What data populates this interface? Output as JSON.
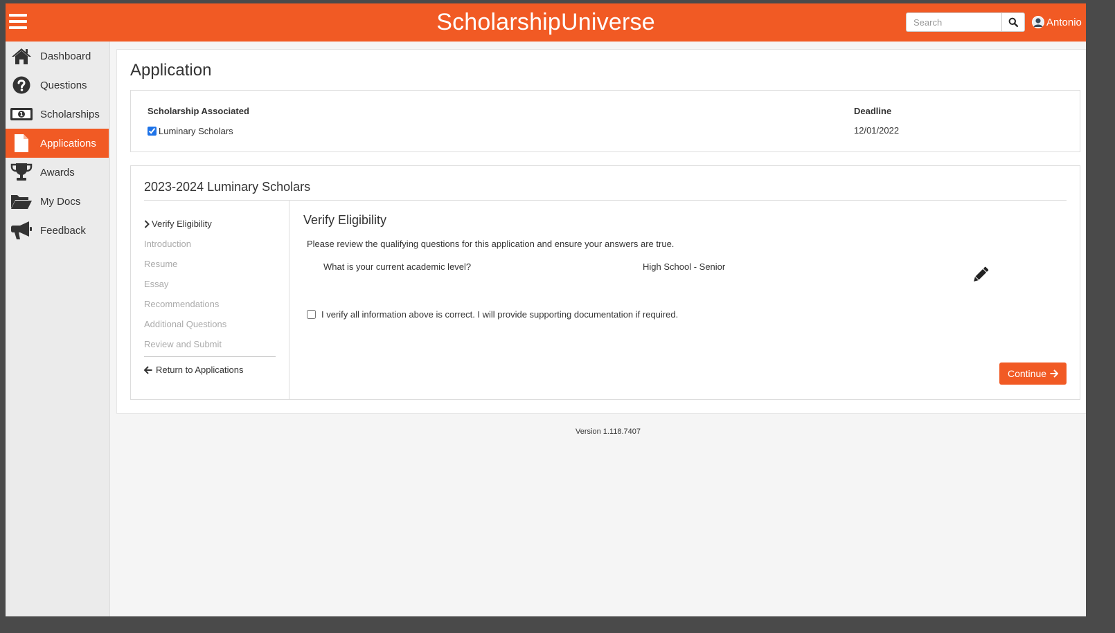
{
  "header": {
    "brand": "ScholarshipUniverse",
    "menu_icon": "hamburger-menu-icon",
    "search": {
      "placeholder": "Search",
      "icon": "search-icon"
    },
    "user": {
      "name": "Antonio",
      "icon": "user-avatar-icon"
    }
  },
  "sidebar": {
    "items": [
      {
        "label": "Dashboard",
        "icon": "home-icon",
        "active": false
      },
      {
        "label": "Questions",
        "icon": "question-circle-icon",
        "active": false
      },
      {
        "label": "Scholarships",
        "icon": "money-bill-icon",
        "active": false
      },
      {
        "label": "Applications",
        "icon": "file-icon",
        "active": true
      },
      {
        "label": "Awards",
        "icon": "trophy-icon",
        "active": false
      },
      {
        "label": "My Docs",
        "icon": "folder-open-icon",
        "active": false
      },
      {
        "label": "Feedback",
        "icon": "bullhorn-icon",
        "active": false
      }
    ]
  },
  "page": {
    "title": "Application",
    "association": {
      "heading": "Scholarship Associated",
      "scholarship": "Luminary Scholars",
      "checked": true,
      "deadline_heading": "Deadline",
      "deadline": "12/01/2022"
    },
    "application": {
      "title": "2023-2024 Luminary Scholars",
      "steps": [
        "Verify Eligibility",
        "Introduction",
        "Resume",
        "Essay",
        "Recommendations",
        "Additional Questions",
        "Review and Submit"
      ],
      "current_step": 0,
      "return_link": "Return to Applications",
      "verify": {
        "title": "Verify Eligibility",
        "description": "Please review the qualifying questions for this application and ensure your answers are true.",
        "question": "What is your current academic level?",
        "answer": "High School - Senior",
        "edit_icon": "pencil-icon",
        "confirm_text": "I verify all information above is correct. I will provide supporting documentation if required.",
        "confirm_checked": false,
        "continue_label": "Continue"
      }
    }
  },
  "footer": {
    "version": "Version 1.118.7407"
  },
  "colors": {
    "brand": "#f15a24",
    "sidebar_bg": "#ebebeb",
    "page_bg": "#f5f5f5",
    "checkbox_accent": "#1e73e8"
  }
}
